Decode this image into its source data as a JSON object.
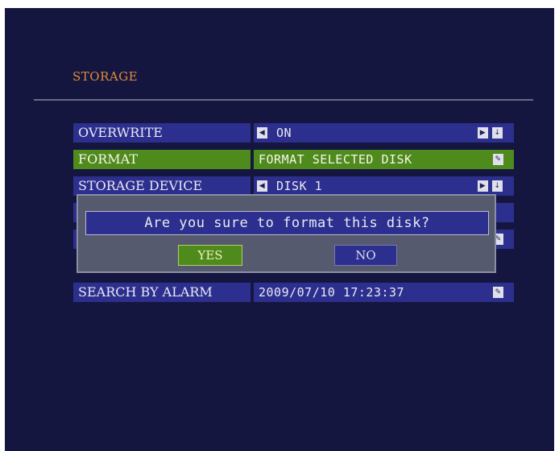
{
  "page": {
    "title": "STORAGE"
  },
  "rows": [
    {
      "label": "OVERWRITE",
      "value": "ON",
      "controls": [
        "left-arrow-icon",
        "right-arrow-icon",
        "down-arrow-icon"
      ]
    },
    {
      "label": "FORMAT",
      "value": "FORMAT SELECTED DISK",
      "controls": [
        "edit-icon"
      ],
      "selected": true
    },
    {
      "label": "STORAGE DEVICE",
      "value": "DISK 1",
      "controls": [
        "left-arrow-icon",
        "right-arrow-icon",
        "down-arrow-icon"
      ]
    },
    {
      "label": "",
      "value": "",
      "controls": []
    },
    {
      "label": "",
      "value": "",
      "controls": [
        "edit-icon"
      ]
    },
    {
      "label": "SEARCH BY ALARM",
      "value": "2009/07/10 17:23:37",
      "controls": [
        "edit-icon"
      ]
    }
  ],
  "dialog": {
    "message": "Are you sure to format this disk?",
    "yes_label": "YES",
    "no_label": "NO"
  },
  "colors": {
    "background": "#15163f",
    "row": "#2d2f8e",
    "selected": "#4e8a1c",
    "title": "#e08a3c",
    "dialog": "#565a6e"
  }
}
